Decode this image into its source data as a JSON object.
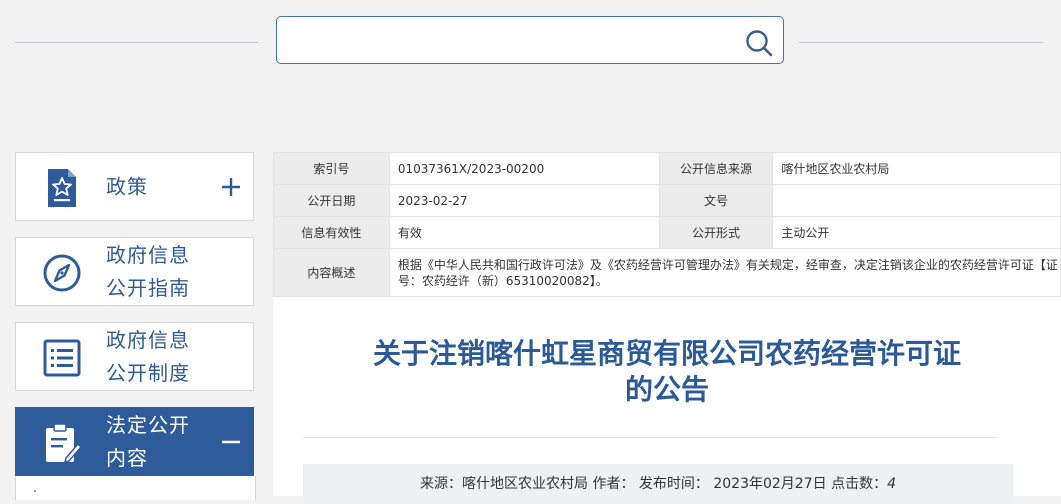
{
  "search": {
    "placeholder": "",
    "value": ""
  },
  "sidebar": {
    "items": [
      {
        "line1": "政策",
        "line2": "",
        "icon": "policy-document-star-icon",
        "state": "collapsed"
      },
      {
        "line1": "政府信息",
        "line2": "公开指南",
        "icon": "compass-icon"
      },
      {
        "line1": "政府信息",
        "line2": "公开制度",
        "icon": "list-icon"
      },
      {
        "line1": "法定公开",
        "line2": "内容",
        "icon": "clipboard-edit-icon",
        "state": "expanded"
      }
    ]
  },
  "meta": {
    "index_label": "索引号",
    "index_value": "01037361X/2023-00200",
    "source_label": "公开信息来源",
    "source_value": "喀什地区农业农村局",
    "date_label": "公开日期",
    "date_value": "2023-02-27",
    "docno_label": "文号",
    "docno_value": "",
    "validity_label": "信息有效性",
    "validity_value": "有效",
    "form_label": "公开形式",
    "form_value": "主动公开",
    "summary_label": "内容概述",
    "summary_value": "根据《中华人民共和国行政许可法》及《农药经营许可管理办法》有关规定，经审查，决定注销该企业的农药经营许可证【证号：农药经许（新）65310020082】。"
  },
  "article": {
    "title_line1": "关于注销喀什虹星商贸有限公司农药经营许可证",
    "title_line2": "的公告",
    "info_source": "来源：喀什地区农业农村局",
    "info_author": "作者：",
    "info_published": "发布时间： 2023年02月27日",
    "info_clicks_label": "点击数：",
    "info_clicks": "4"
  },
  "colors": {
    "brand_blue": "#2e5b99",
    "title_blue": "#2c5a97"
  }
}
